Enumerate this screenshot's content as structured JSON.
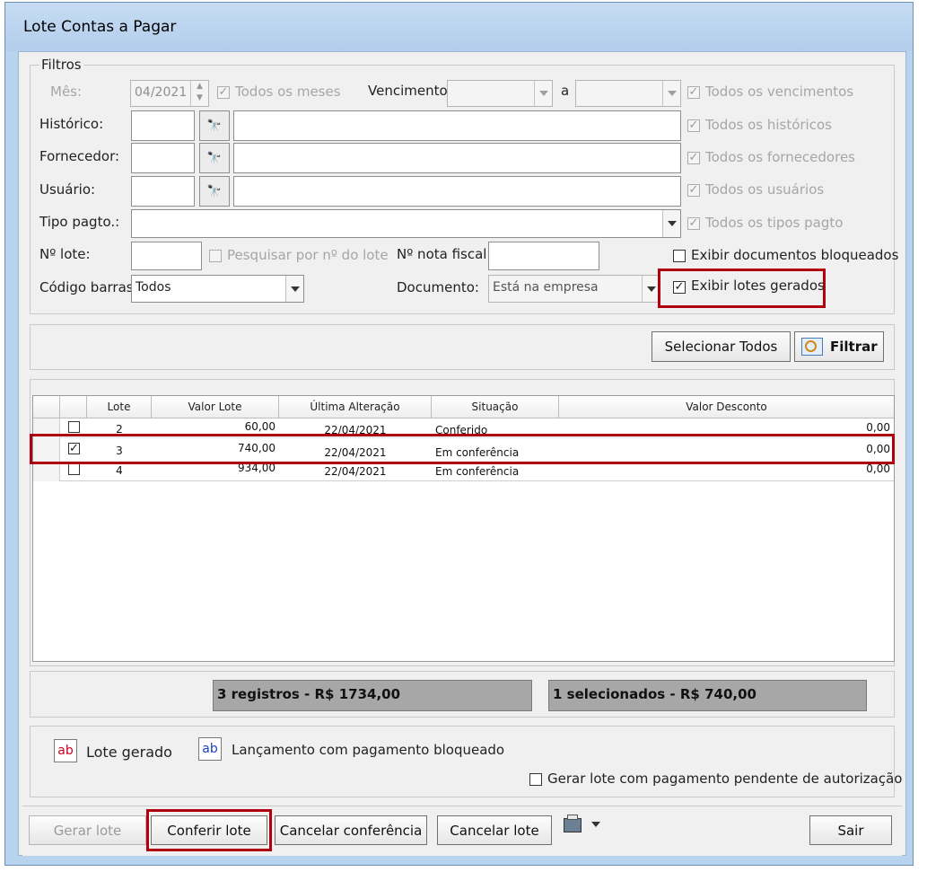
{
  "window": {
    "title": "Lote Contas a Pagar"
  },
  "filters": {
    "legend": "Filtros",
    "mes": {
      "label": "Mês:",
      "value": "04/2021",
      "all_label": "Todos os meses"
    },
    "vencimento": {
      "label": "Vencimento:",
      "from_value": "",
      "sep": "a",
      "to_value": "",
      "all_label": "Todos os vencimentos"
    },
    "historico": {
      "label": "Histórico:",
      "code": "",
      "name": "",
      "all_label": "Todos os históricos"
    },
    "fornecedor": {
      "label": "Fornecedor:",
      "code": "",
      "name": "",
      "all_label": "Todos os fornecedores"
    },
    "usuario": {
      "label": "Usuário:",
      "code": "",
      "name": "",
      "all_label": "Todos os usuários"
    },
    "tipo_pagto": {
      "label": "Tipo pagto.:",
      "value": "",
      "all_label": "Todos os tipos pagto"
    },
    "n_lote": {
      "label": "Nº lote:",
      "value": "",
      "search_label": "Pesquisar por nº do lote"
    },
    "nota_fiscal": {
      "label": "Nº nota fiscal:",
      "value": ""
    },
    "codigo_barras": {
      "label": "Código barras",
      "value": "Todos"
    },
    "documento": {
      "label": "Documento:",
      "value": "Está na empresa"
    },
    "exibir_bloqueados": {
      "label": "Exibir documentos bloqueados",
      "checked": false
    },
    "exibir_lotes": {
      "label": "Exibir lotes gerados",
      "checked": true
    }
  },
  "actions": {
    "select_all": "Selecionar Todos",
    "filter": "Filtrar"
  },
  "table": {
    "columns": [
      "Lote",
      "Valor Lote",
      "Última Alteração",
      "Situação",
      "Valor Desconto"
    ],
    "rows": [
      {
        "checked": false,
        "lote": "2",
        "valor": "60,00",
        "data": "22/04/2021",
        "situacao": "Conferido",
        "desconto": "0,00"
      },
      {
        "checked": true,
        "lote": "3",
        "valor": "740,00",
        "data": "22/04/2021",
        "situacao": "Em conferência",
        "desconto": "0,00"
      },
      {
        "checked": false,
        "lote": "4",
        "valor": "934,00",
        "data": "22/04/2021",
        "situacao": "Em conferência",
        "desconto": "0,00"
      }
    ]
  },
  "totals": {
    "registros": "3 registros - R$ 1734,00",
    "selecionados": "1 selecionados - R$ 740,00"
  },
  "legend": {
    "icon_text": "ab",
    "lote_gerado": "Lote gerado",
    "lancamento_bloqueado": "Lançamento com pagamento bloqueado",
    "gerar_pendente": "Gerar lote com pagamento pendente de autorização",
    "red_color": "#d0021b",
    "blue_color": "#1a3fc4"
  },
  "footer": {
    "gerar_lote": "Gerar lote",
    "conferir_lote": "Conferir lote",
    "cancelar_conferencia": "Cancelar conferência",
    "cancelar_lote": "Cancelar lote",
    "sair": "Sair",
    "printer_icon": "printer-icon"
  }
}
